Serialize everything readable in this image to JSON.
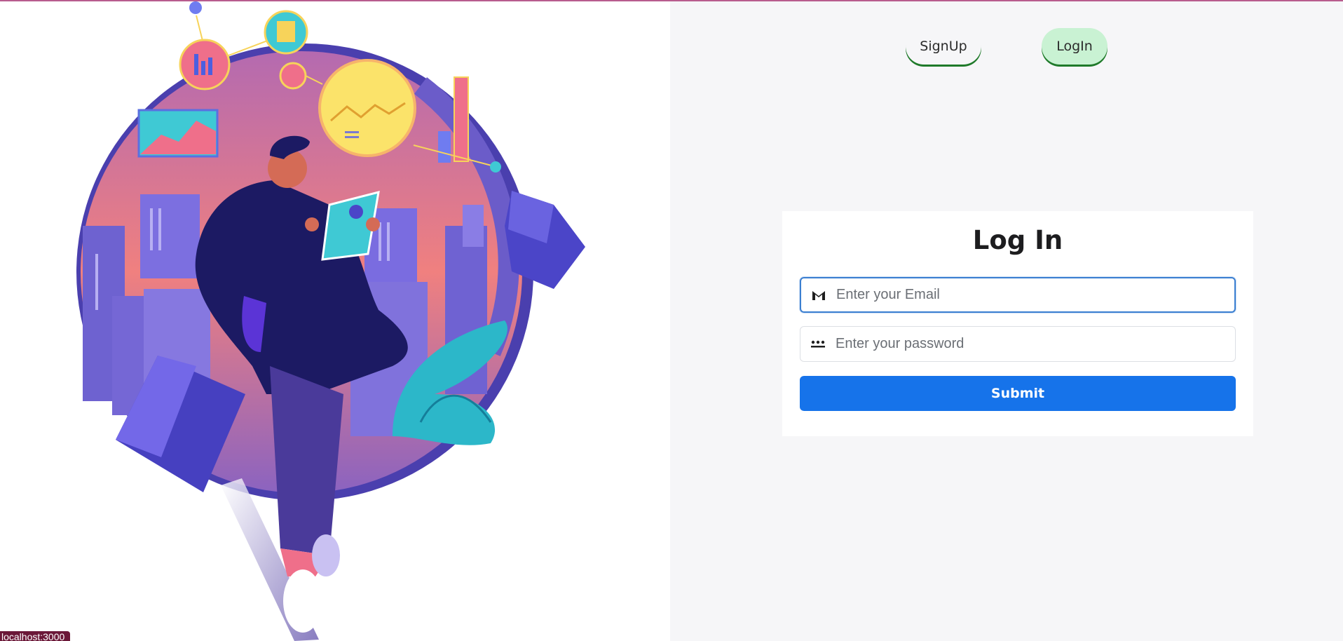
{
  "nav": {
    "signup_label": "SignUp",
    "login_label": "LogIn"
  },
  "form": {
    "title": "Log In",
    "email_placeholder": "Enter your Email",
    "email_value": "",
    "password_placeholder": "Enter your password",
    "password_value": "",
    "submit_label": "Submit"
  },
  "icons": {
    "email": "gmail-icon",
    "password": "password-dots-icon"
  },
  "status_bar": {
    "url": "localhost:3000"
  },
  "colors": {
    "primary": "#1673ea",
    "login_active_bg": "#c9f2d3",
    "accent_underline": "#1f7a2a",
    "status_bg": "#6b1838"
  }
}
